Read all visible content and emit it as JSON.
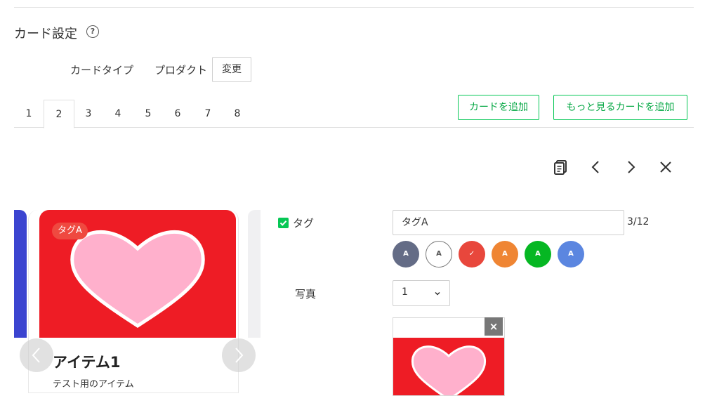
{
  "section": {
    "title": "カード設定",
    "help_icon": "?"
  },
  "card_type": {
    "label": "カードタイプ",
    "value": "プロダクト",
    "change_button": "変更"
  },
  "tabs": [
    "1",
    "2",
    "3",
    "4",
    "5",
    "6",
    "7",
    "8"
  ],
  "active_tab": "2",
  "actions": {
    "add_card": "カードを追加",
    "add_more_card": "もっと見るカードを追加"
  },
  "toolbar_icons": [
    "copy-icon",
    "chevron-left-icon",
    "chevron-right-icon",
    "close-icon"
  ],
  "preview": {
    "tag_badge": "タグA",
    "item_title": "アイテム1",
    "item_description": "テスト用のアイテム"
  },
  "form": {
    "tag_label": "タグ",
    "tag_enabled": true,
    "tag_value": "タグA",
    "tag_counter": "3/12",
    "color_options": [
      {
        "label": "A",
        "color": "#646c86",
        "selected": false
      },
      {
        "label": "A",
        "color": "#ffffff",
        "selected": false
      },
      {
        "label": "✓",
        "color": "#e8473c",
        "selected": true
      },
      {
        "label": "A",
        "color": "#ef8533",
        "selected": false
      },
      {
        "label": "A",
        "color": "#06b723",
        "selected": false
      },
      {
        "label": "A",
        "color": "#5b86e0",
        "selected": false
      }
    ],
    "photo_label": "写真",
    "photo_select_value": "1",
    "photo_remove": "×"
  },
  "colors": {
    "accent_green": "#06c755",
    "card_red": "#ee1c25",
    "heart_pink": "#ffb0cc"
  }
}
